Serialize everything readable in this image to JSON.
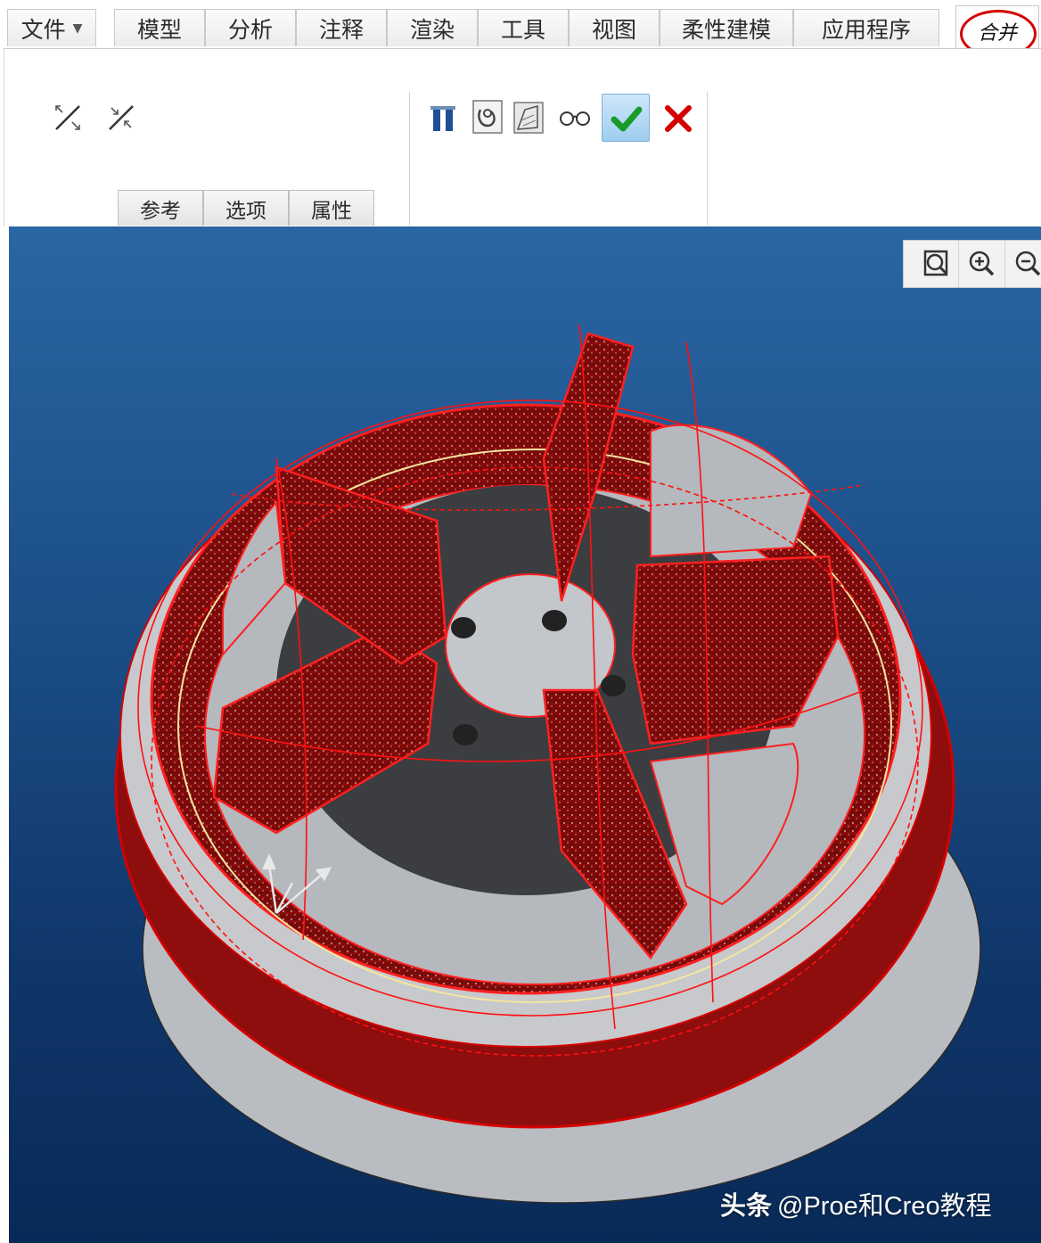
{
  "menu": {
    "file": "文件",
    "tabs": [
      "模型",
      "分析",
      "注释",
      "渲染",
      "工具",
      "视图",
      "柔性建模",
      "应用程序"
    ],
    "active_tab": "合并",
    "highlight_color": "#d40000"
  },
  "ribbon": {
    "icons_left": [
      "swap-arrows-icon",
      "swap-arrows-alt-icon"
    ],
    "tools": [
      "pause-icon",
      "preview-icon",
      "feature-preview-icon",
      "glasses-icon",
      "ok-check-icon",
      "cancel-x-icon"
    ],
    "subtabs": [
      "参考",
      "选项",
      "属性"
    ]
  },
  "view_toolbar": {
    "buttons": [
      "zoom-fit-icon",
      "zoom-in-icon",
      "zoom-out-icon"
    ]
  },
  "colors": {
    "background_top": "#2a66a3",
    "background_bottom": "#082a57",
    "accent_red": "#d40000",
    "ok_green": "#1a9a2a"
  },
  "watermark": {
    "brand": "头条",
    "text": "@Proe和Creo教程"
  }
}
